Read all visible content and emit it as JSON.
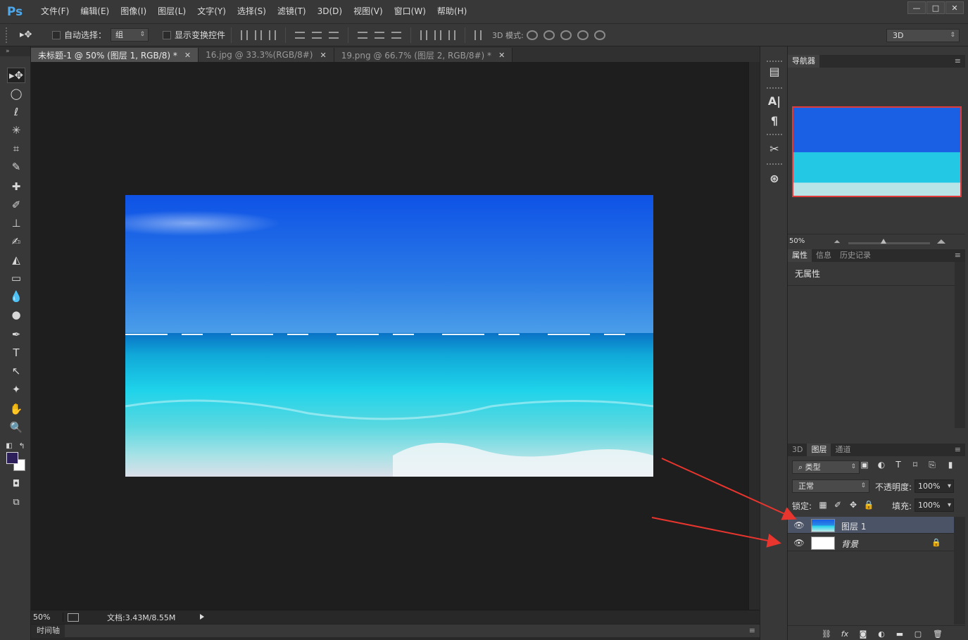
{
  "app": {
    "logo": "Ps"
  },
  "menu": [
    "文件(F)",
    "编辑(E)",
    "图像(I)",
    "图层(L)",
    "文字(Y)",
    "选择(S)",
    "滤镜(T)",
    "3D(D)",
    "视图(V)",
    "窗口(W)",
    "帮助(H)"
  ],
  "window_controls": {
    "minimize": "—",
    "maximize": "□",
    "close": "✕"
  },
  "options": {
    "tool_glyph": "▸✥",
    "auto_select_label": "自动选择：",
    "auto_select_value": "组",
    "show_transform_label": "显示变换控件",
    "mode_3d_label": "3D 模式:",
    "workspace": "3D"
  },
  "tabs": [
    {
      "label": "未标题-1 @ 50% (图层 1, RGB/8) *",
      "close": "✕"
    },
    {
      "label": "16.jpg @ 33.3%(RGB/8#)",
      "close": "✕"
    },
    {
      "label": "19.png @ 66.7% (图层 2, RGB/8#) *",
      "close": "✕"
    }
  ],
  "tools": [
    {
      "name": "move-tool",
      "glyph": "▸✥"
    },
    {
      "name": "elliptical-marquee-tool",
      "glyph": "◯"
    },
    {
      "name": "lasso-tool",
      "glyph": "ℓ"
    },
    {
      "name": "magic-wand-tool",
      "glyph": "✳"
    },
    {
      "name": "crop-tool",
      "glyph": "⌗"
    },
    {
      "name": "eyedropper-tool",
      "glyph": "✎"
    },
    {
      "name": "healing-brush-tool",
      "glyph": "✚"
    },
    {
      "name": "brush-tool",
      "glyph": "✐"
    },
    {
      "name": "clone-stamp-tool",
      "glyph": "⊥"
    },
    {
      "name": "history-brush-tool",
      "glyph": "✍"
    },
    {
      "name": "eraser-tool",
      "glyph": "◭"
    },
    {
      "name": "gradient-tool",
      "glyph": "▭"
    },
    {
      "name": "blur-tool",
      "glyph": "💧"
    },
    {
      "name": "dodge-tool",
      "glyph": "●"
    },
    {
      "name": "pen-tool",
      "glyph": "✒"
    },
    {
      "name": "type-tool",
      "glyph": "T"
    },
    {
      "name": "path-selection-tool",
      "glyph": "↖"
    },
    {
      "name": "custom-shape-tool",
      "glyph": "✦"
    },
    {
      "name": "hand-tool",
      "glyph": "✋"
    },
    {
      "name": "zoom-tool",
      "glyph": "🔍"
    }
  ],
  "colors": {
    "foreground": "#2d1f5a",
    "background": "#ffffff",
    "accent_arrow": "#e8352e",
    "nav_border": "#e03a3a",
    "selected_layer": "#4b5366"
  },
  "status": {
    "zoom": "50%",
    "doc": "文档:3.43M/8.55M"
  },
  "timeline": {
    "label": "时间轴"
  },
  "navigator": {
    "tab": "导航器",
    "zoom": "50%"
  },
  "properties": {
    "tabs": [
      "属性",
      "信息",
      "历史记录"
    ],
    "title": "无属性"
  },
  "layers_panel": {
    "tabs": [
      "3D",
      "图层",
      "通道"
    ],
    "filter_kind": "类型",
    "blend_mode": "正常",
    "opacity_label": "不透明度:",
    "opacity_value": "100%",
    "lock_label": "锁定:",
    "fill_label": "填充:",
    "fill_value": "100%",
    "layers": [
      {
        "name": "图层 1",
        "selected": true
      },
      {
        "name": "背景",
        "locked": true,
        "selected": false
      }
    ]
  }
}
